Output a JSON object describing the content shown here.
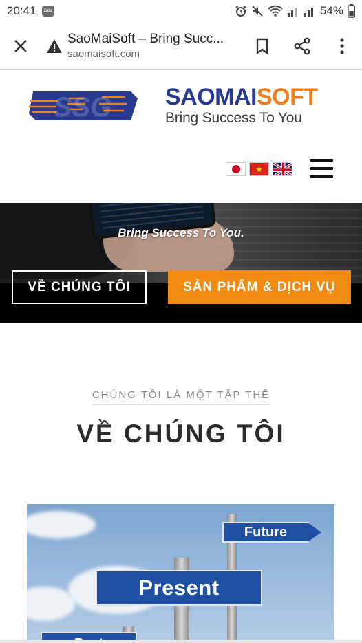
{
  "status_bar": {
    "time": "20:41",
    "app_badge": "Zalo",
    "battery": "54%"
  },
  "browser": {
    "page_title": "SaoMaiSoft – Bring Succ...",
    "url": "saomaisoft.com"
  },
  "site": {
    "logo_text": "SSG",
    "brand_part1": "SAOMAI",
    "brand_part2": "SOFT",
    "tagline": "Bring Success To You",
    "colors": {
      "brand_blue": "#273a8f",
      "brand_orange": "#ef7d1a",
      "cta_orange": "#f08a10"
    }
  },
  "hero": {
    "tagline": "Bring Success To You.",
    "button_about": "VỀ CHÚNG TÔI",
    "button_products": "SẢN PHẨM & DỊCH VỤ"
  },
  "about": {
    "subtitle": "CHÚNG TÔI LÀ MỘT TẬP THỂ",
    "title": "VỀ CHÚNG TÔI"
  },
  "photo": {
    "sign_future": "Future",
    "sign_present": "Present",
    "sign_past": "Past"
  }
}
